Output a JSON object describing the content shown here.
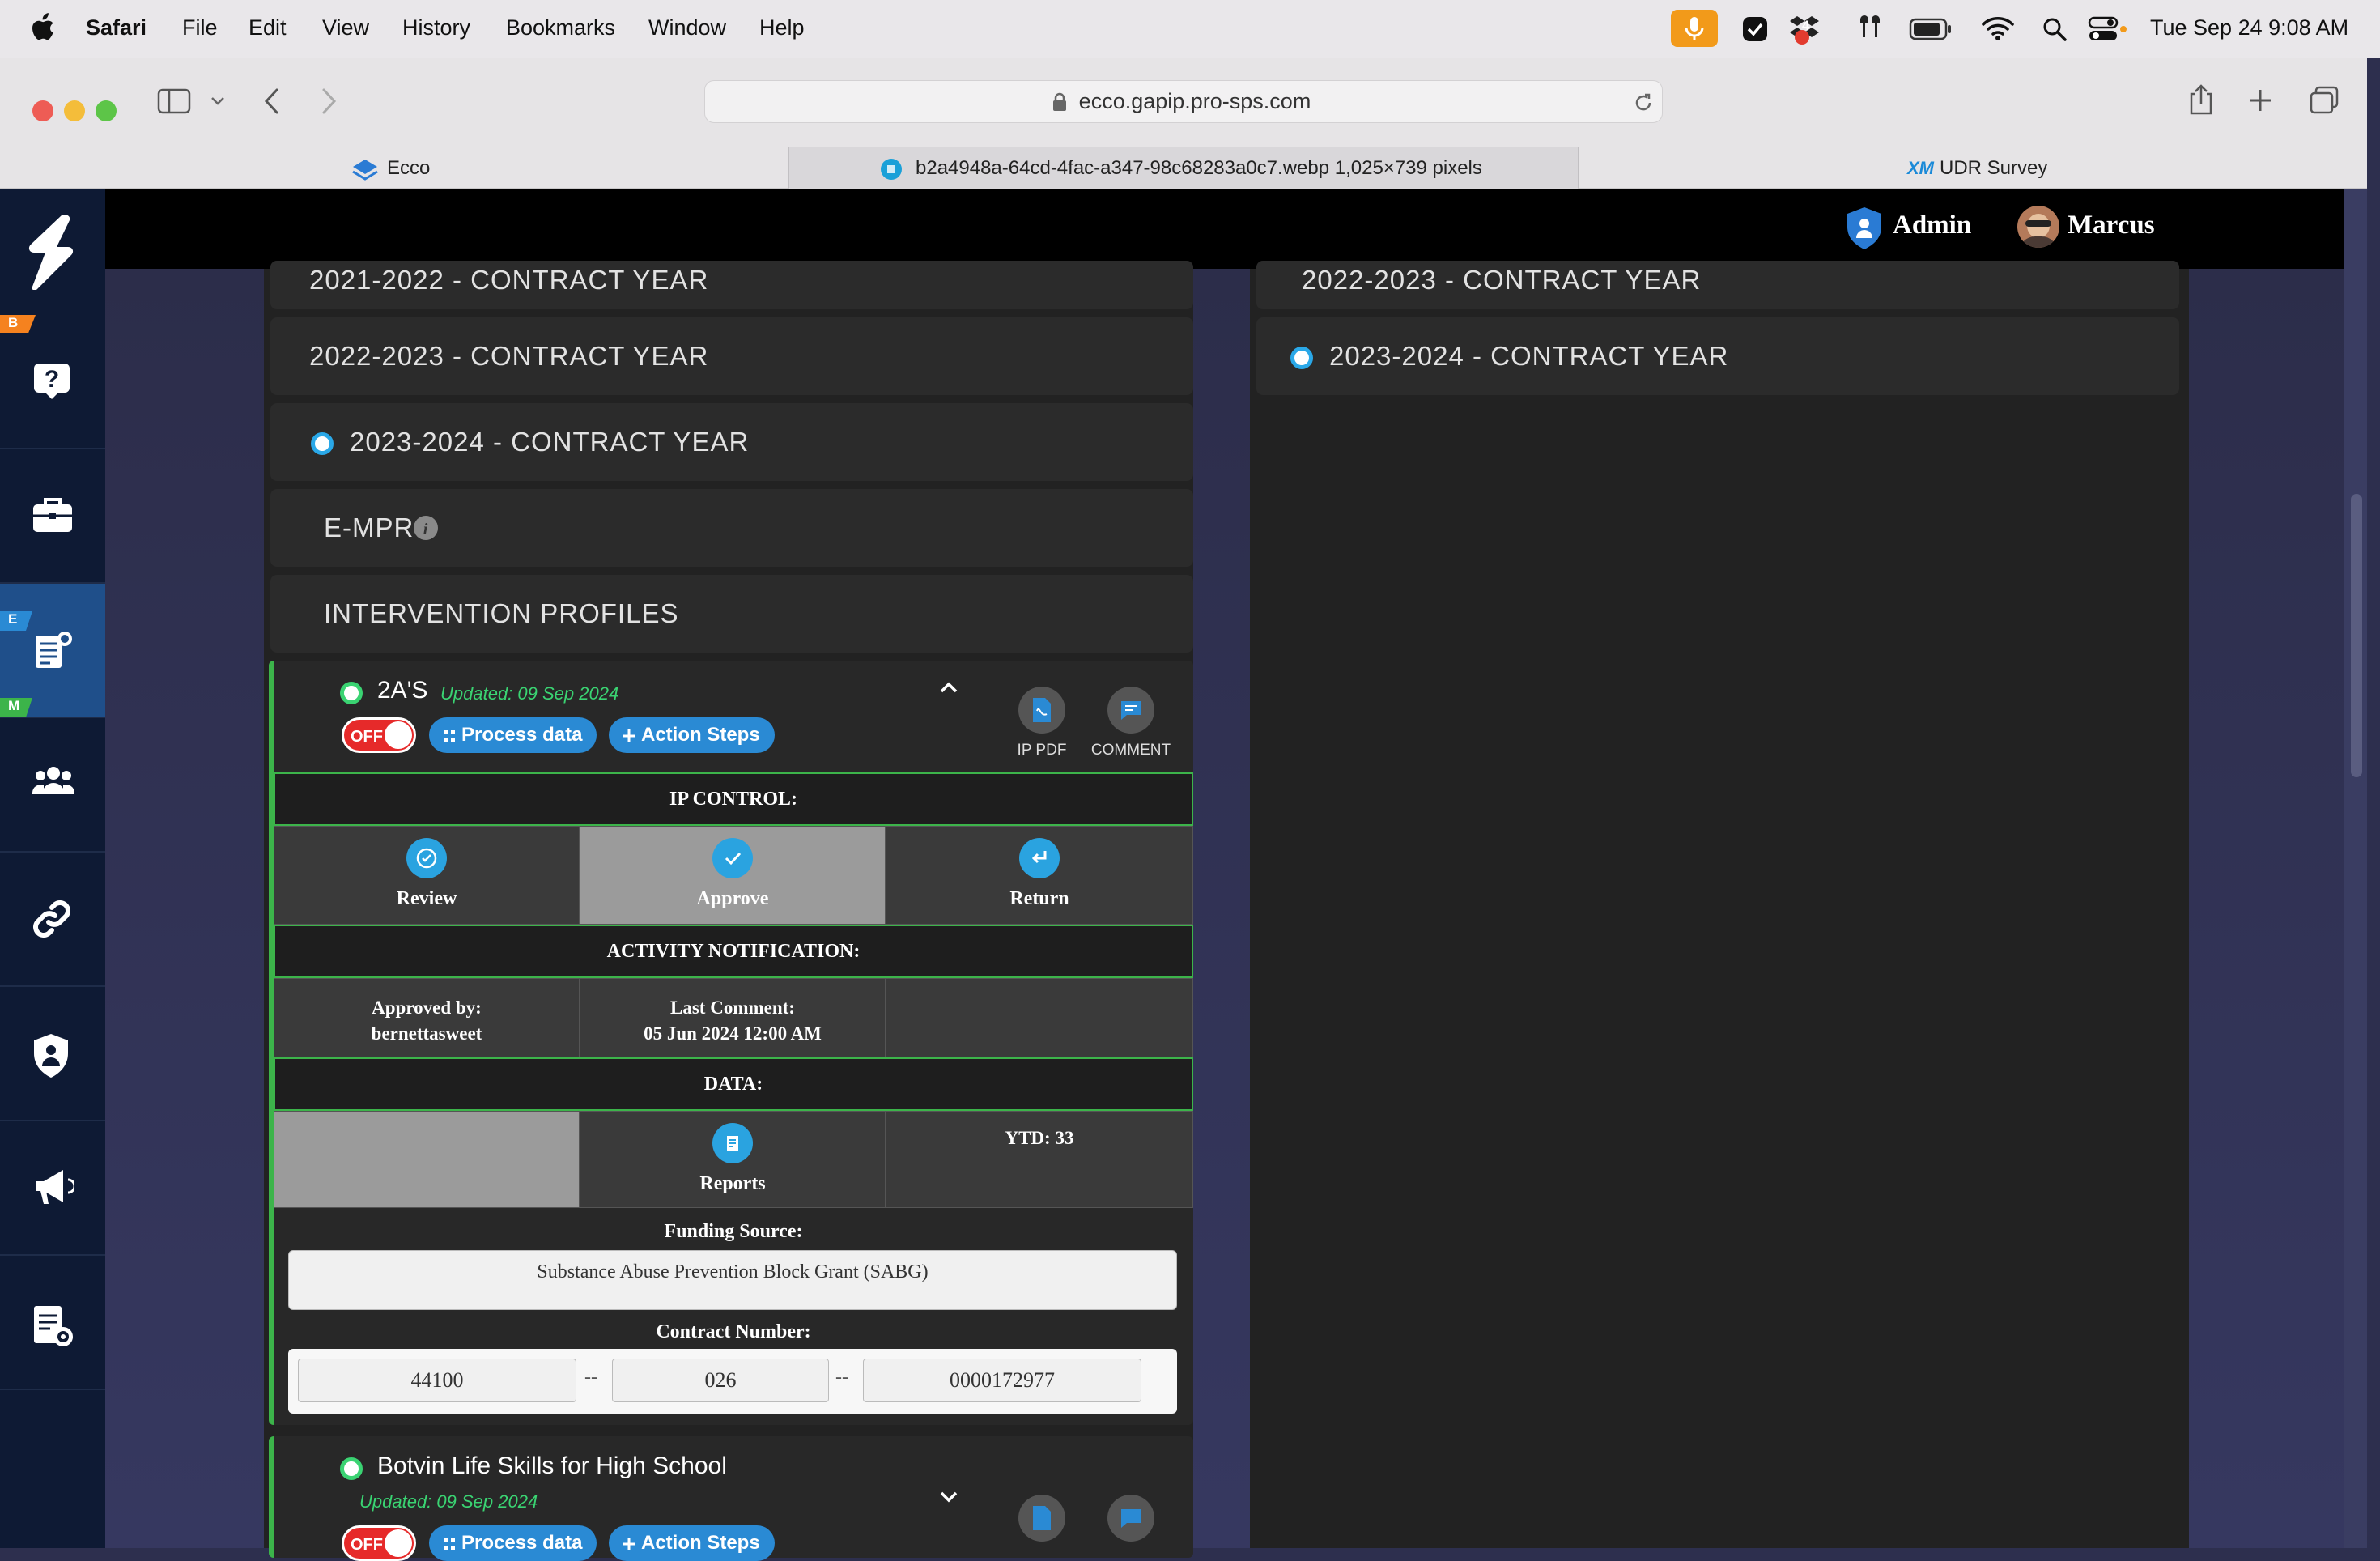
{
  "menubar": {
    "app": "Safari",
    "items": [
      "File",
      "Edit",
      "View",
      "History",
      "Bookmarks",
      "Window",
      "Help"
    ],
    "clock": "Tue Sep 24  9:08 AM",
    "dropbox_badge": "4"
  },
  "browser": {
    "url": "ecco.gapip.pro-sps.com",
    "tabs": [
      {
        "label": "Ecco"
      },
      {
        "label": "b2a4948a-64cd-4fac-a347-98c68283a0c7.webp 1,025×739 pixels"
      },
      {
        "label": "UDR Survey"
      }
    ],
    "tab3_icon_text": "XM"
  },
  "sidebar": {
    "badge_b": "B",
    "badge_e": "E",
    "badge_m": "M"
  },
  "header": {
    "admin_label": "Admin",
    "user_label": "Marcus"
  },
  "left": {
    "years": [
      {
        "label": "2021-2022 - CONTRACT YEAR"
      },
      {
        "label": "2022-2023 - CONTRACT YEAR"
      },
      {
        "label": "2023-2024 - CONTRACT YEAR"
      }
    ],
    "empr_label": "E-MPR",
    "ip_label": "INTERVENTION PROFILES"
  },
  "card1": {
    "title": "2A'S",
    "updated": "Updated: 09 Sep 2024",
    "toggle": "OFF",
    "process_label": "Process data",
    "action_label": "Action Steps",
    "ippdf_label": "IP PDF",
    "comment_label": "COMMENT",
    "ip_control_label": "IP CONTROL:",
    "review_label": "Review",
    "approve_label": "Approve",
    "return_label": "Return",
    "activity_label": "ACTIVITY NOTIFICATION:",
    "approved_by_label": "Approved by:",
    "approved_by_value": "bernettasweet",
    "last_comment_label": "Last Comment:",
    "last_comment_value": "05 Jun 2024 12:00 AM",
    "data_label": "DATA:",
    "reports_label": "Reports",
    "ytd_label": "YTD:",
    "ytd_value": "33",
    "funding_label": "Funding Source:",
    "funding_value": "Substance Abuse Prevention Block Grant (SABG)",
    "contract_label": "Contract Number:",
    "contract_part1": "44100",
    "contract_part2": "026",
    "contract_part3": "0000172977",
    "sep": "--"
  },
  "card2": {
    "title": "Botvin Life Skills for High School",
    "updated": "Updated: 09 Sep 2024",
    "toggle": "OFF",
    "process_label": "Process data",
    "action_label": "Action Steps"
  },
  "right": {
    "years": [
      {
        "label": "2022-2023 - CONTRACT YEAR"
      },
      {
        "label": "2023-2024 - CONTRACT YEAR"
      }
    ]
  },
  "colors": {
    "accent_blue": "#2a8ad4",
    "approve_green": "#3cb44a",
    "off_red": "#e62a2a"
  }
}
